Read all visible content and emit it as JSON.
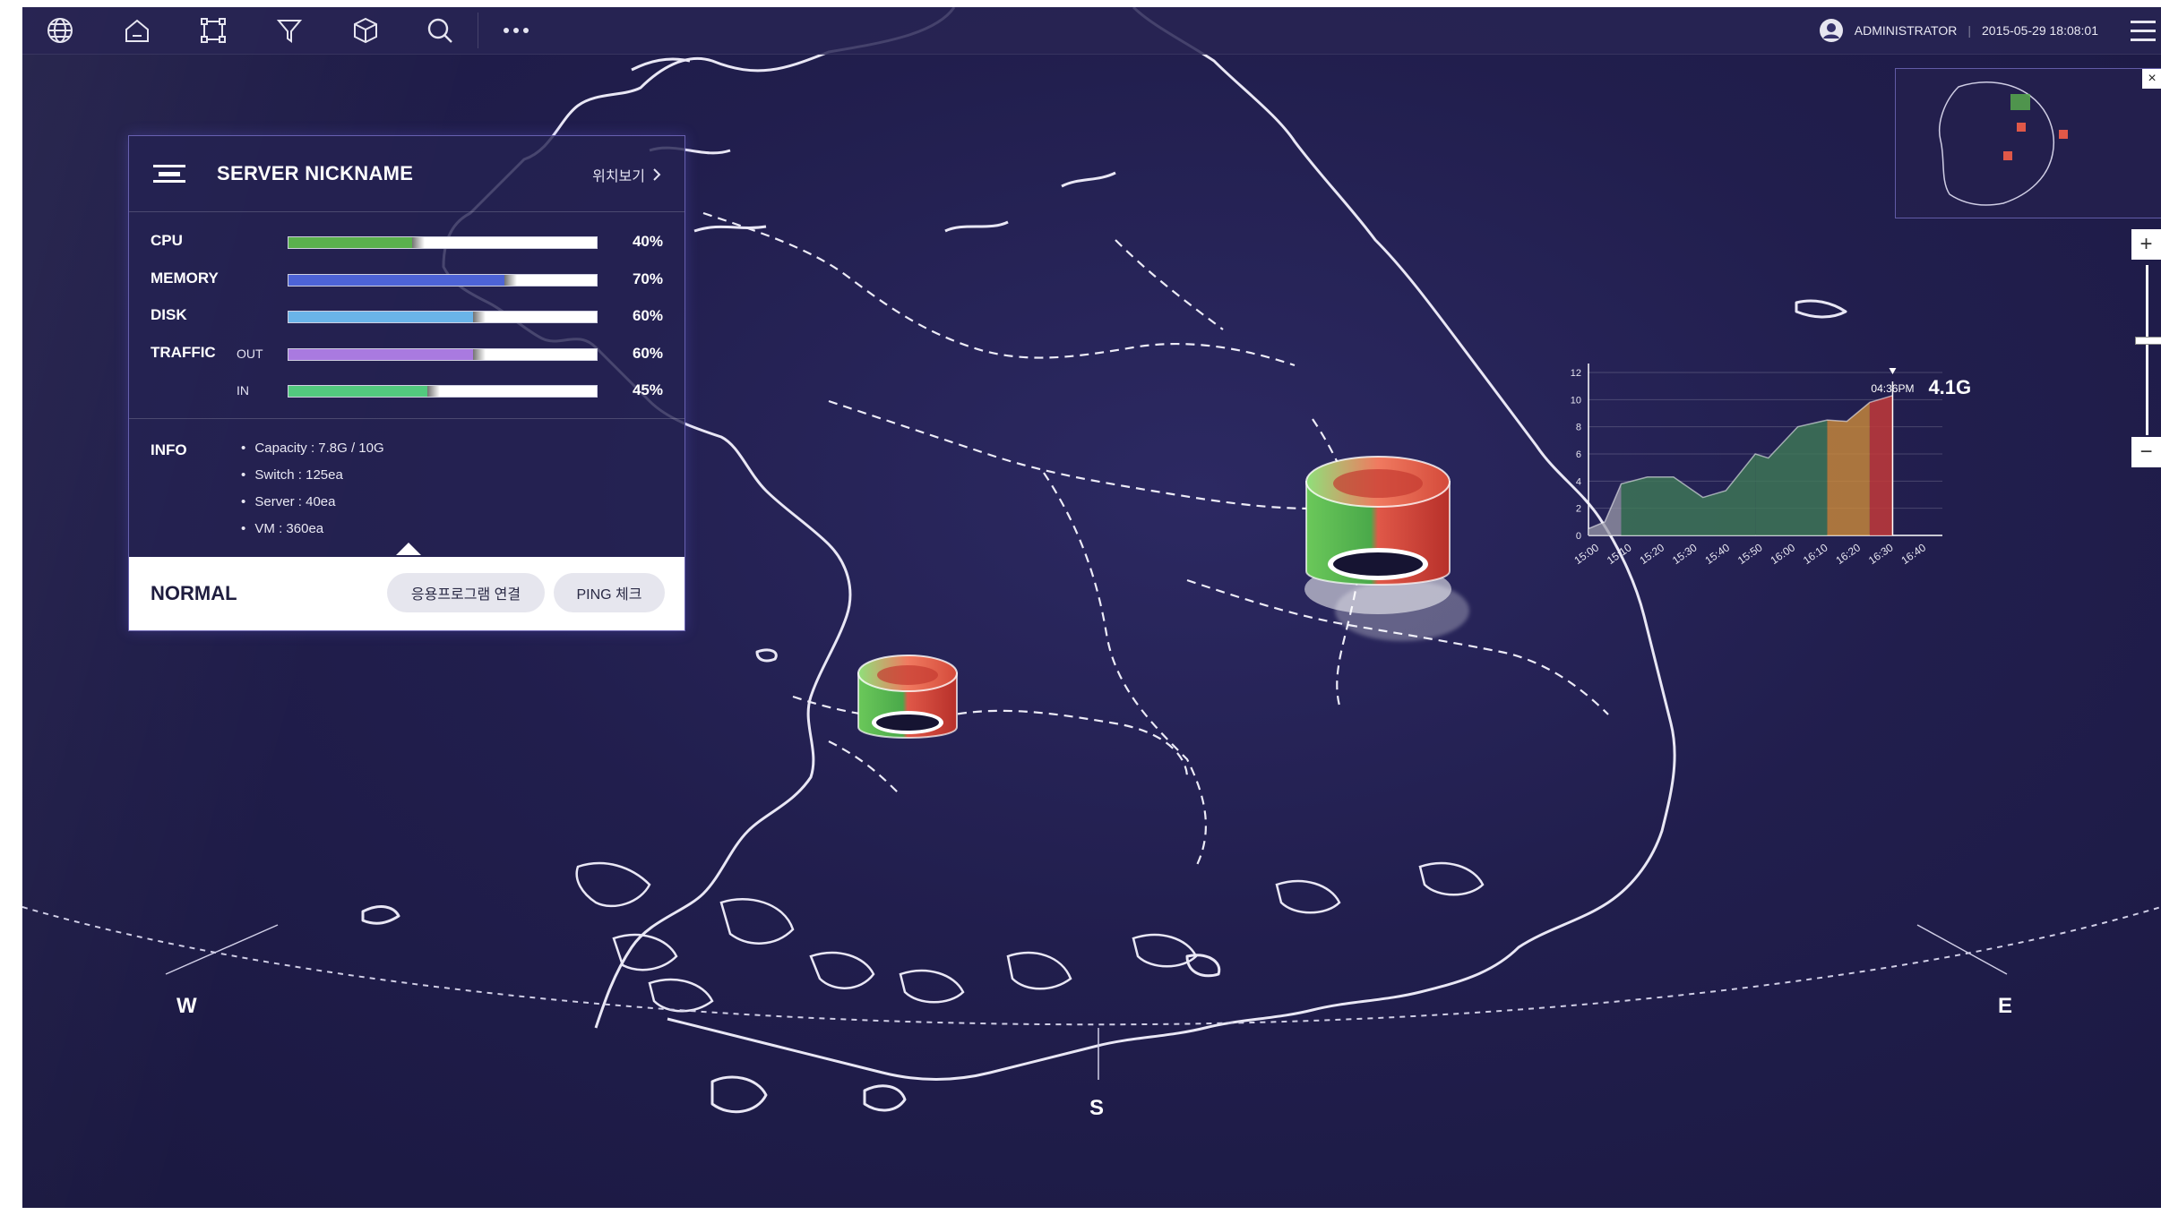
{
  "topbar": {
    "icons": [
      "globe-icon",
      "home-icon",
      "network-icon",
      "filter-icon",
      "cube-icon",
      "search-icon",
      "more-icon"
    ],
    "user": "ADMINISTRATOR",
    "datetime": "2015-05-29 18:08:01"
  },
  "panel": {
    "title": "SERVER NICKNAME",
    "location_link": "위치보기",
    "metrics": [
      {
        "label": "CPU",
        "sub": "",
        "pct_text": "40%",
        "value": 0.4,
        "color": "#5ab14d"
      },
      {
        "label": "MEMORY",
        "sub": "",
        "pct_text": "70%",
        "value": 0.7,
        "color": "#4d63d6"
      },
      {
        "label": "DISK",
        "sub": "",
        "pct_text": "60%",
        "value": 0.6,
        "color": "#6ab4e8"
      },
      {
        "label": "TRAFFIC",
        "sub": "OUT",
        "pct_text": "60%",
        "value": 0.6,
        "color": "#a97ae0"
      },
      {
        "label": "",
        "sub": "IN",
        "pct_text": "45%",
        "value": 0.45,
        "color": "#52c97e"
      }
    ],
    "info_label": "INFO",
    "info_items": [
      "Capacity : 7.8G / 10G",
      "Switch : 125ea",
      "Server : 40ea",
      "VM : 360ea"
    ],
    "status": "NORMAL",
    "btn_app": "응용프로그램 연결",
    "btn_ping": "PING 체크"
  },
  "compass": {
    "west": "W",
    "east": "E",
    "south": "S"
  },
  "zoom": {
    "plus": "+",
    "minus": "−",
    "level": 0.56
  },
  "chart_data": {
    "type": "area",
    "x": [
      "15:00",
      "15:10",
      "15:20",
      "15:30",
      "15:40",
      "15:50",
      "16:00",
      "16:10",
      "16:20",
      "16:30",
      "16:40"
    ],
    "values": [
      0.5,
      1,
      3.8,
      4.3,
      4.3,
      2.8,
      3.3,
      6,
      5.7,
      8,
      8.5,
      8.4,
      9.8,
      10.3
    ],
    "value_x": [
      0,
      0.5,
      1,
      1.8,
      2.6,
      3.5,
      4.2,
      5.1,
      5.5,
      6.4,
      7.3,
      7.9,
      8.6,
      9.3
    ],
    "ylim": [
      0,
      12
    ],
    "yticks": [
      "0",
      "2",
      "4",
      "6",
      "8",
      "10",
      "12"
    ],
    "grid": true,
    "segment_colors": [
      "#9a9aa8",
      "#3e7a56",
      "#cd8b3a",
      "#c23a3a"
    ],
    "marker_label": "04:36PM",
    "marker_value": "4.1G"
  },
  "colors": {
    "background": "#211e4d",
    "panel_border": "#a096ff",
    "accent": "#ffffff"
  }
}
